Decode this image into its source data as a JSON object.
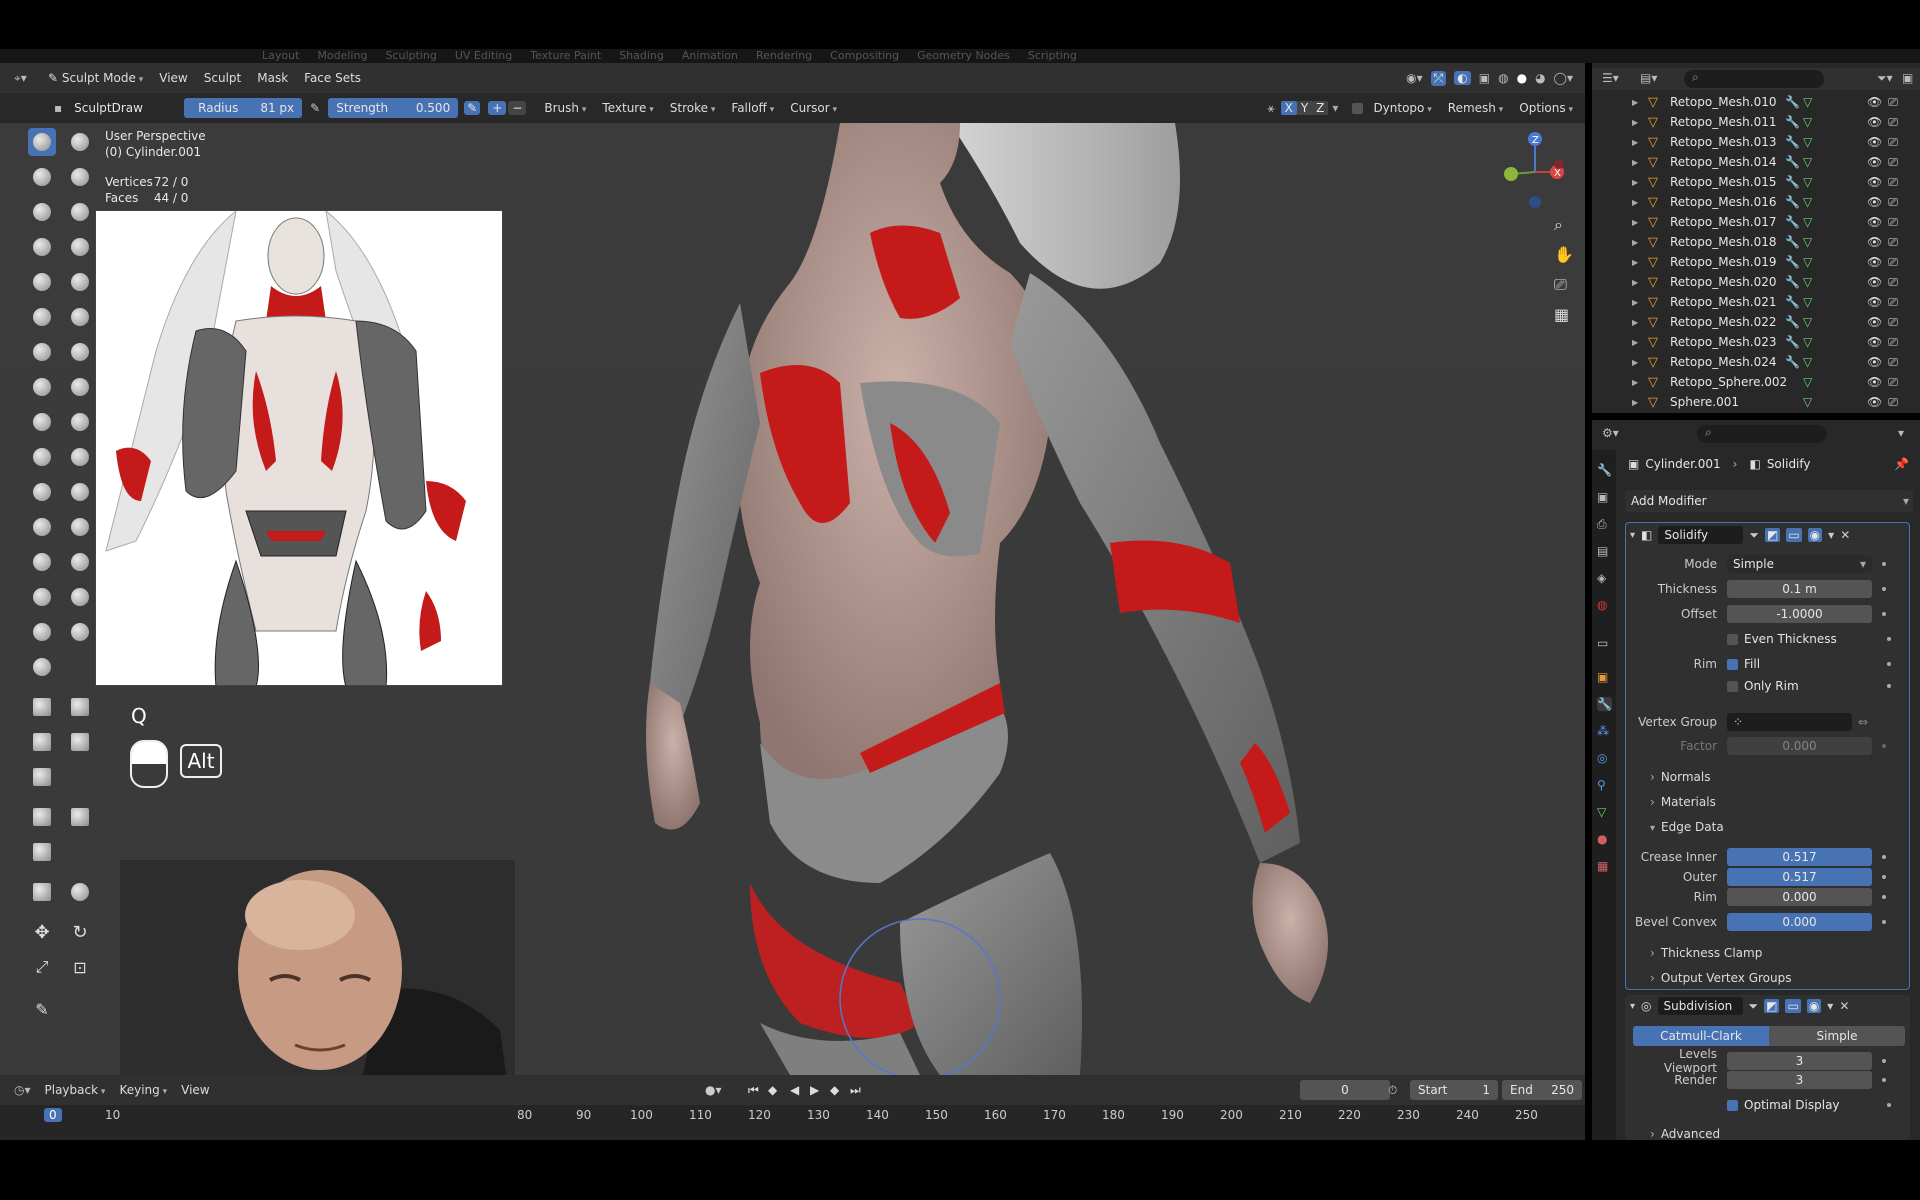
{
  "workspace_tabs": [
    "Layout",
    "Modeling",
    "Sculpting",
    "UV Editing",
    "Texture Paint",
    "Shading",
    "Animation",
    "Rendering",
    "Compositing",
    "Geometry Nodes",
    "Scripting"
  ],
  "viewport_header": {
    "mode": "Sculpt Mode",
    "menus": [
      "View",
      "Sculpt",
      "Mask",
      "Face Sets"
    ]
  },
  "tool_header": {
    "brush_name": "SculptDraw",
    "radius_label": "Radius",
    "radius_value": "81 px",
    "strength_label": "Strength",
    "strength_value": "0.500",
    "menus": [
      "Brush",
      "Texture",
      "Stroke",
      "Falloff",
      "Cursor"
    ],
    "axes": [
      "X",
      "Y",
      "Z"
    ],
    "dyntopo": "Dyntopo",
    "remesh": "Remesh",
    "options": "Options"
  },
  "viewport_overlay": {
    "perspective": "User Perspective",
    "object": "(0) Cylinder.001",
    "vertices_label": "Vertices",
    "vertices_value": "72 / 0",
    "faces_label": "Faces",
    "faces_value": "44 / 0"
  },
  "key_overlay": {
    "key": "Q",
    "modifier": "Alt"
  },
  "timeline": {
    "menus": [
      "Playback",
      "Keying",
      "View"
    ],
    "current_frame": "0",
    "start_label": "Start",
    "start_value": "1",
    "end_label": "End",
    "end_value": "250",
    "ruler": [
      "0",
      "10",
      "80",
      "90",
      "100",
      "110",
      "120",
      "130",
      "140",
      "150",
      "160",
      "170",
      "180",
      "190",
      "200",
      "210",
      "220",
      "230",
      "240",
      "250"
    ]
  },
  "outliner": {
    "items": [
      "Retopo_Mesh.010",
      "Retopo_Mesh.011",
      "Retopo_Mesh.013",
      "Retopo_Mesh.014",
      "Retopo_Mesh.015",
      "Retopo_Mesh.016",
      "Retopo_Mesh.017",
      "Retopo_Mesh.018",
      "Retopo_Mesh.019",
      "Retopo_Mesh.020",
      "Retopo_Mesh.021",
      "Retopo_Mesh.022",
      "Retopo_Mesh.023",
      "Retopo_Mesh.024",
      "Retopo_Sphere.002",
      "Sphere.001"
    ]
  },
  "properties": {
    "breadcrumb_object": "Cylinder.001",
    "breadcrumb_modifier": "Solidify",
    "add_modifier": "Add Modifier",
    "solidify": {
      "name": "Solidify",
      "mode_label": "Mode",
      "mode_value": "Simple",
      "thickness_label": "Thickness",
      "thickness_value": "0.1 m",
      "offset_label": "Offset",
      "offset_value": "-1.0000",
      "even_thickness": "Even Thickness",
      "rim_label": "Rim",
      "fill": "Fill",
      "only_rim": "Only Rim",
      "vgroup_label": "Vertex Group",
      "factor_label": "Factor",
      "factor_value": "0.000",
      "normals": "Normals",
      "materials": "Materials",
      "edge_data": "Edge Data",
      "crease_inner_label": "Crease Inner",
      "crease_inner_value": "0.517",
      "outer_label": "Outer",
      "outer_value": "0.517",
      "rim2_label": "Rim",
      "rim2_value": "0.000",
      "bevel_label": "Bevel Convex",
      "bevel_value": "0.000",
      "thickness_clamp": "Thickness Clamp",
      "output_vgroups": "Output Vertex Groups"
    },
    "subdivision": {
      "name": "Subdivision",
      "catmull": "Catmull-Clark",
      "simple": "Simple",
      "levels_label": "Levels Viewport",
      "levels_value": "3",
      "render_label": "Render",
      "render_value": "3",
      "optimal": "Optimal Display",
      "advanced": "Advanced"
    }
  }
}
